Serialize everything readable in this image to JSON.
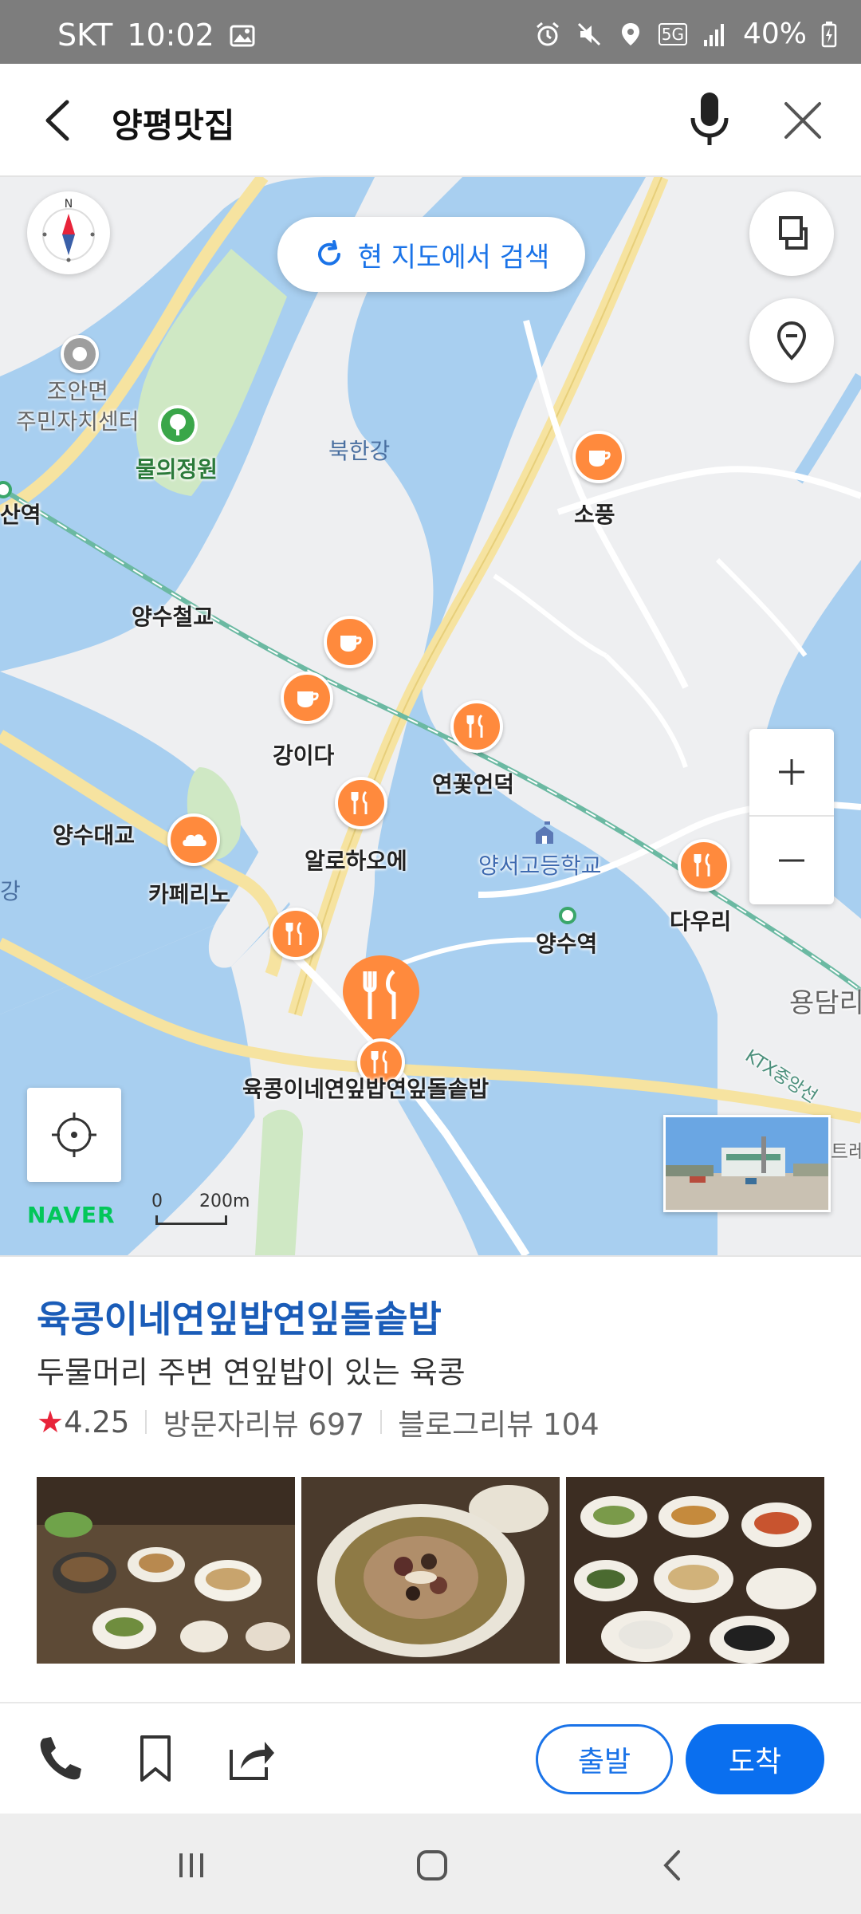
{
  "status_bar": {
    "carrier": "SKT",
    "time": "10:02",
    "network": "5G",
    "battery": "40%"
  },
  "search": {
    "query": "양평맛집"
  },
  "map": {
    "search_here_label": "현 지도에서 검색",
    "labels": {
      "joan_office": "조안면\n주민자치센터",
      "mului_garden": "물의정원",
      "bukhan_river": "북한강",
      "station_left": "산역",
      "yangsu_iron_bridge": "양수철교",
      "yangsu_bridge": "양수대교",
      "river_left": "강",
      "school": "양서고등학교",
      "yangsu_station": "양수역",
      "yongdam": "용담리",
      "ktx_line": "KTX중앙선",
      "right_edge": "트레"
    },
    "pins": [
      {
        "name": "소풍",
        "type": "cafe"
      },
      {
        "name": "강이다",
        "type": "cafe"
      },
      {
        "name": "연꽃언덕",
        "type": "restaurant"
      },
      {
        "name": "알로하오에",
        "type": "restaurant"
      },
      {
        "name": "카페리노",
        "type": "bakery"
      },
      {
        "name": "다우리",
        "type": "restaurant"
      },
      {
        "name": "육콩이네연잎밥연잎돌솥밥",
        "type": "restaurant",
        "selected": true
      }
    ],
    "naver_logo": "NAVER",
    "scale_zero": "0",
    "scale_label": "200m",
    "colors": {
      "water": "#a8cff0",
      "land": "#eeeff1",
      "park": "#cfe8c4",
      "road": "#f6e3a0",
      "pin": "#ff8a3d",
      "rail": "#6bb9a2"
    }
  },
  "place": {
    "name": "육콩이네연잎밥연잎돌솥밥",
    "description": "두물머리 주변 연잎밥이 있는 육콩",
    "rating": "4.25",
    "visitor_reviews": "방문자리뷰 697",
    "blog_reviews": "블로그리뷰 104"
  },
  "actions": {
    "depart": "출발",
    "arrive": "도착"
  }
}
